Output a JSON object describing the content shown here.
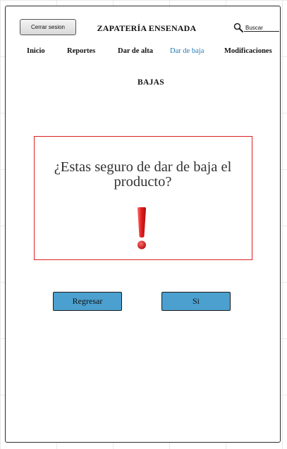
{
  "header": {
    "logout_label": "Cerrar sesion",
    "app_title": "ZAPATERÍA ENSENADA",
    "search": {
      "placeholder": "Buscar"
    }
  },
  "nav": {
    "items": [
      {
        "label": "Inicio"
      },
      {
        "label": "Reportes"
      },
      {
        "label": "Dar de alta"
      },
      {
        "label": "Dar de baja",
        "active": true
      },
      {
        "label": "Modificaciones"
      }
    ]
  },
  "page": {
    "section_title": "BAJAS"
  },
  "dialog": {
    "message_line1": "¿Estas seguro de dar de baja el",
    "message_line2": "producto?",
    "icon": "exclamation-icon"
  },
  "actions": {
    "back_label": "Regresar",
    "confirm_label": "Si"
  },
  "colors": {
    "accent": "#4ba0cf",
    "active_nav": "#1f7ab3",
    "dialog_border": "#dd1f1f",
    "warning": "#e01b1b"
  }
}
